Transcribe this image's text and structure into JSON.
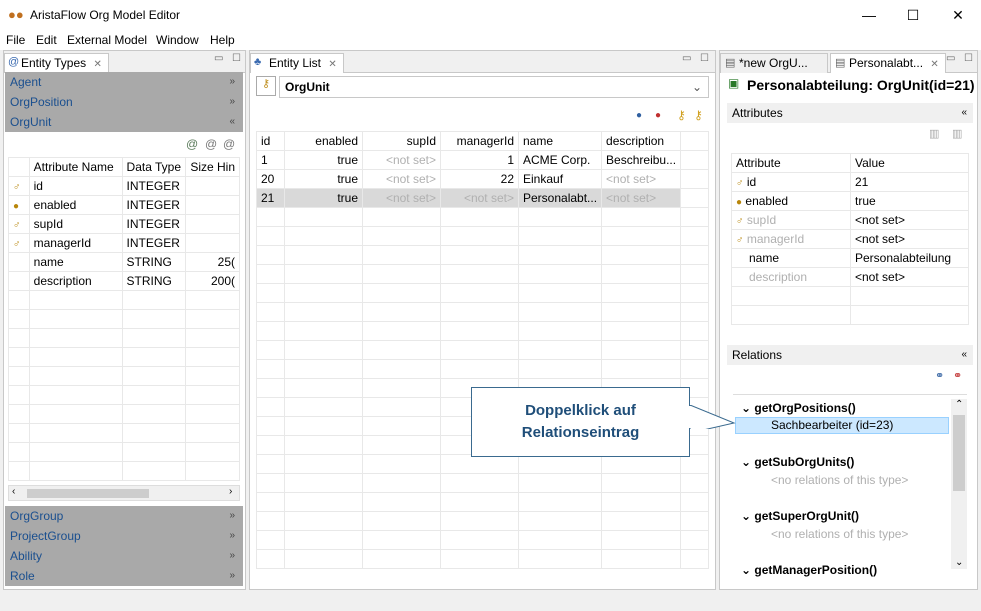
{
  "window": {
    "title": "AristaFlow Org Model Editor",
    "minimize": "—",
    "maximize": "☐",
    "close": "✕"
  },
  "menu": [
    "File",
    "Edit",
    "External Model",
    "Window",
    "Help"
  ],
  "entity_types": {
    "tab_label": "Entity Types",
    "sections_top": [
      "Agent",
      "OrgPosition",
      "OrgUnit"
    ],
    "sections_bottom": [
      "OrgGroup",
      "ProjectGroup",
      "Ability",
      "Role"
    ],
    "columns": [
      "Attribute Name",
      "Data Type",
      "Size Hin"
    ],
    "rows": [
      {
        "name": "id",
        "type": "INTEGER",
        "size": ""
      },
      {
        "name": "enabled",
        "type": "INTEGER",
        "size": ""
      },
      {
        "name": "supId",
        "type": "INTEGER",
        "size": ""
      },
      {
        "name": "managerId",
        "type": "INTEGER",
        "size": ""
      },
      {
        "name": "name",
        "type": "STRING",
        "size": "25("
      },
      {
        "name": "description",
        "type": "STRING",
        "size": "200("
      }
    ]
  },
  "entity_list": {
    "tab_label": "Entity List",
    "selected_type": "OrgUnit",
    "columns": [
      "id",
      "enabled",
      "supId",
      "managerId",
      "name",
      "description"
    ],
    "rows": [
      {
        "id": "1",
        "enabled": "true",
        "supId": "<not set>",
        "managerId": "1",
        "name": "ACME Corp.",
        "description": "Beschreibu..."
      },
      {
        "id": "20",
        "enabled": "true",
        "supId": "<not set>",
        "managerId": "22",
        "name": "Einkauf",
        "description": "<not set>"
      },
      {
        "id": "21",
        "enabled": "true",
        "supId": "<not set>",
        "managerId": "<not set>",
        "name": "Personalabt...",
        "description": "<not set>"
      }
    ]
  },
  "detail": {
    "tab1_label": "*new OrgU...",
    "tab2_label": "Personalabt...",
    "heading": "Personalabteilung: OrgUnit(id=21)",
    "attributes_label": "Attributes",
    "attr_columns": [
      "Attribute",
      "Value"
    ],
    "attrs": [
      {
        "name": "id",
        "value": "21"
      },
      {
        "name": "enabled",
        "value": "true"
      },
      {
        "name": "supId",
        "value": "<not set>"
      },
      {
        "name": "managerId",
        "value": "<not set>"
      },
      {
        "name": "name",
        "value": "Personalabteilung"
      },
      {
        "name": "description",
        "value": "<not set>"
      }
    ],
    "relations_label": "Relations",
    "relations": [
      {
        "name": "getOrgPositions()",
        "entry": "Sachbearbeiter (id=23)"
      },
      {
        "name": "getSubOrgUnits()",
        "entry": "<no relations of this type>"
      },
      {
        "name": "getSuperOrgUnit()",
        "entry": "<no relations of this type>"
      },
      {
        "name": "getManagerPosition()",
        "entry": ""
      }
    ]
  },
  "callout": {
    "line1": "Doppelklick auf",
    "line2": "Relationseintrag"
  },
  "colors": {
    "section_bg": "#a9a9a9",
    "section_text": "#1a4f8f",
    "selection": "#cce8ff",
    "callout_text": "#1f4e79"
  }
}
